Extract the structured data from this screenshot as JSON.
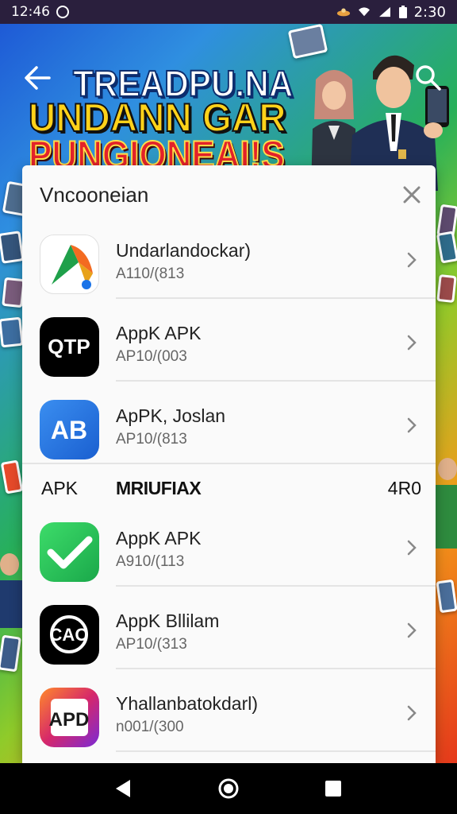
{
  "status_bar": {
    "time_left": "12:46",
    "time_right": "2:30",
    "icons": [
      "notification-icon",
      "app-notification-icon",
      "signal-icon",
      "wifi-icon",
      "battery-icon"
    ]
  },
  "banner": {
    "line1": "TREADPU.NA",
    "line2": "UNDANN GAR",
    "line3": "PUNGIONEAI!S",
    "colors": {
      "line1": "#ffffff",
      "line2": "#ffd21a",
      "line3": "#e3222a"
    }
  },
  "sheet": {
    "title": "Vncooneian",
    "apps_top": [
      {
        "name": "Undarlandockar)",
        "sub": "A110/(813",
        "icon": "a-logo-icon"
      },
      {
        "name": "AppK APK",
        "sub": "AP10/(003",
        "icon": "qtp-logo-icon"
      },
      {
        "name": "ApPK, Joslan",
        "sub": "AP10/(813",
        "icon": "ab-logo-icon"
      }
    ],
    "section": {
      "left": "APK",
      "middle": "MRIUFIAX",
      "right": "4R0"
    },
    "apps_bottom": [
      {
        "name": "AppK APK",
        "sub": "A910/(113",
        "icon": "checkmark-logo-icon"
      },
      {
        "name": "AppK Bllilam",
        "sub": "AP10/(313",
        "icon": "cao-logo-icon"
      },
      {
        "name": "Yhallanbatokdarl)",
        "sub": "n001/(300",
        "icon": "apd-logo-icon"
      }
    ]
  },
  "accent_colors": {
    "sheet_bg": "#fafafa",
    "divider": "#e4e4e4",
    "nav_bg": "#000000"
  }
}
